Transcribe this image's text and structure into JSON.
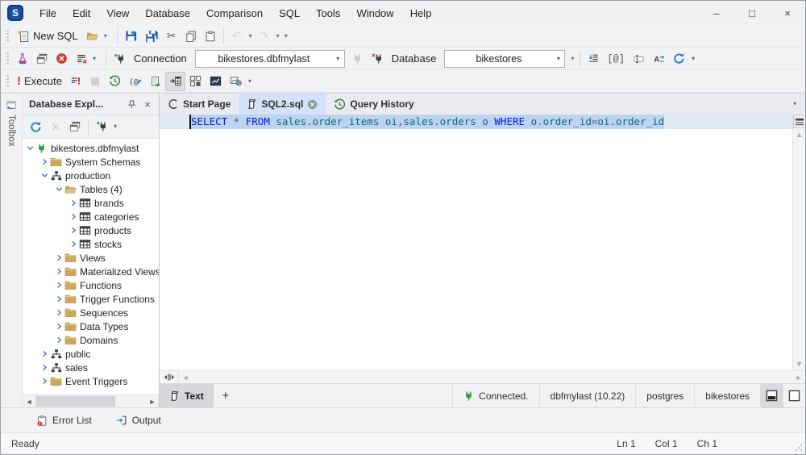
{
  "app": {
    "logo_letter": "S"
  },
  "menubar": {
    "items": [
      "File",
      "Edit",
      "View",
      "Database",
      "Comparison",
      "SQL",
      "Tools",
      "Window",
      "Help"
    ]
  },
  "icons": {
    "minimize": "–",
    "maximize": "□",
    "close": "×",
    "dropdown": "▾",
    "cut": "✂",
    "undo": "↶",
    "redo": "↷",
    "panel_close": "×",
    "clear_x": "×",
    "scroll_up": "▲",
    "scroll_down": "▼",
    "scroll_left": "◄",
    "scroll_right": "►",
    "parameters": "[@]",
    "at_edit": "(@"
  },
  "toolbars": {
    "standard": {
      "new_sql_label": "New SQL"
    },
    "connection": {
      "connection_label": "Connection",
      "connection_value": "bikestores.dbfmylast",
      "database_label": "Database",
      "database_value": "bikestores"
    },
    "execute": {
      "execute_label": "Execute",
      "execute_mark": "!"
    }
  },
  "toolbox_tab": {
    "label": "Toolbox"
  },
  "explorer": {
    "title": "Database Expl...",
    "tree": [
      {
        "label": "bikestores.dbfmylast",
        "level": 0,
        "icon": "connection",
        "expand": "expanded"
      },
      {
        "label": "System Schemas",
        "level": 1,
        "icon": "folder",
        "expand": "collapsed"
      },
      {
        "label": "production",
        "level": 1,
        "icon": "schema",
        "expand": "expanded"
      },
      {
        "label": "Tables (4)",
        "level": 2,
        "icon": "folder-open",
        "expand": "expanded"
      },
      {
        "label": "brands",
        "level": 3,
        "icon": "table",
        "expand": "collapsed"
      },
      {
        "label": "categories",
        "level": 3,
        "icon": "table",
        "expand": "collapsed"
      },
      {
        "label": "products",
        "level": 3,
        "icon": "table",
        "expand": "collapsed"
      },
      {
        "label": "stocks",
        "level": 3,
        "icon": "table",
        "expand": "collapsed"
      },
      {
        "label": "Views",
        "level": 2,
        "icon": "folder",
        "expand": "collapsed"
      },
      {
        "label": "Materialized Views",
        "level": 2,
        "icon": "folder",
        "expand": "collapsed"
      },
      {
        "label": "Functions",
        "level": 2,
        "icon": "folder",
        "expand": "collapsed"
      },
      {
        "label": "Trigger Functions",
        "level": 2,
        "icon": "folder",
        "expand": "collapsed"
      },
      {
        "label": "Sequences",
        "level": 2,
        "icon": "folder",
        "expand": "collapsed"
      },
      {
        "label": "Data Types",
        "level": 2,
        "icon": "folder",
        "expand": "collapsed"
      },
      {
        "label": "Domains",
        "level": 2,
        "icon": "folder",
        "expand": "collapsed"
      },
      {
        "label": "public",
        "level": 1,
        "icon": "schema",
        "expand": "collapsed"
      },
      {
        "label": "sales",
        "level": 1,
        "icon": "schema",
        "expand": "collapsed"
      },
      {
        "label": "Event Triggers",
        "level": 1,
        "icon": "folder",
        "expand": "collapsed"
      }
    ]
  },
  "document_tabs": [
    {
      "label": "Start Page",
      "icon": "start-page",
      "active": false,
      "closable": false
    },
    {
      "label": "SQL2.sql",
      "icon": "sql-doc",
      "active": true,
      "closable": true
    },
    {
      "label": "Query History",
      "icon": "history",
      "active": false,
      "closable": false
    }
  ],
  "editor": {
    "sql_text": "SELECT * FROM sales.order_items oi,sales.orders o WHERE o.order_id=oi.order_id",
    "tokens": [
      [
        "kw",
        "SELECT"
      ],
      [
        "op",
        " "
      ],
      [
        "op",
        "*"
      ],
      [
        "op",
        " "
      ],
      [
        "kw",
        "FROM"
      ],
      [
        "op",
        " "
      ],
      [
        "id",
        "sales"
      ],
      [
        "op",
        "."
      ],
      [
        "id",
        "order_items"
      ],
      [
        "op",
        " "
      ],
      [
        "id",
        "oi"
      ],
      [
        "op",
        ","
      ],
      [
        "id",
        "sales"
      ],
      [
        "op",
        "."
      ],
      [
        "id",
        "orders"
      ],
      [
        "op",
        " "
      ],
      [
        "id",
        "o"
      ],
      [
        "op",
        " "
      ],
      [
        "kw",
        "WHERE"
      ],
      [
        "op",
        " "
      ],
      [
        "id",
        "o"
      ],
      [
        "op",
        "."
      ],
      [
        "id",
        "order_id"
      ],
      [
        "op",
        "="
      ],
      [
        "id",
        "oi"
      ],
      [
        "op",
        "."
      ],
      [
        "id",
        "order_id"
      ]
    ]
  },
  "result_tabs": {
    "text_label": "Text",
    "add_label": "+"
  },
  "connection_bar": {
    "status": "Connected.",
    "server": "dbfmylast (10.22)",
    "user": "postgres",
    "database": "bikestores"
  },
  "panel_bar": {
    "error_list_label": "Error List",
    "output_label": "Output"
  },
  "status_bar": {
    "state": "Ready",
    "line": "Ln 1",
    "column": "Col 1",
    "char": "Ch 1"
  },
  "colors": {
    "logo_blue": "#1b4fa0",
    "keyword": "#0018d8",
    "identifier": "#006e6e",
    "operator": "#5a5a5a",
    "selection": "#bed3f1",
    "line_highlight": "#e2e9f8",
    "active_tab": "#d3e2f8",
    "execute_red": "#c0322b",
    "connected_green": "#2f9e44",
    "folder_tan": "#cda95e"
  }
}
